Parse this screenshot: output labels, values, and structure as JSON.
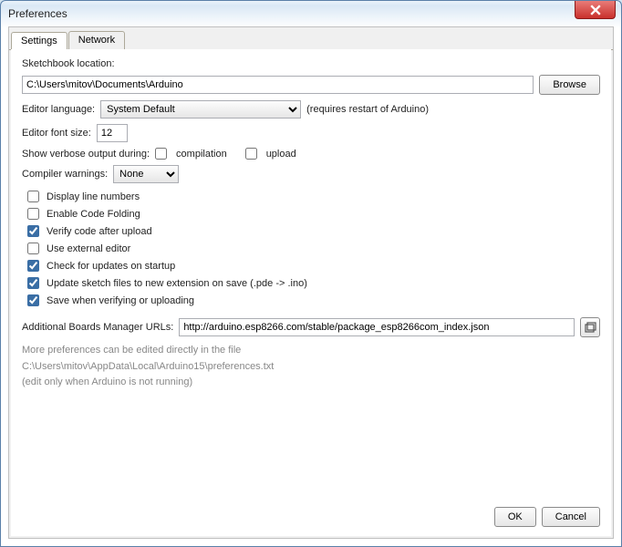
{
  "window": {
    "title": "Preferences"
  },
  "tabs": {
    "settings": "Settings",
    "network": "Network"
  },
  "sketchbook": {
    "label": "Sketchbook location:",
    "value": "C:\\Users\\mitov\\Documents\\Arduino",
    "browse": "Browse"
  },
  "language": {
    "label": "Editor language:",
    "value": "System Default",
    "note": "(requires restart of Arduino)"
  },
  "fontsize": {
    "label": "Editor font size:",
    "value": "12"
  },
  "verbose": {
    "label": "Show verbose output during:",
    "compilation": "compilation",
    "upload": "upload"
  },
  "warnings": {
    "label": "Compiler warnings:",
    "value": "None"
  },
  "checks": {
    "line_numbers": "Display line numbers",
    "code_folding": "Enable Code Folding",
    "verify_upload": "Verify code after upload",
    "external_editor": "Use external editor",
    "check_updates": "Check for updates on startup",
    "update_ext": "Update sketch files to new extension on save (.pde -> .ino)",
    "save_verify": "Save when verifying or uploading"
  },
  "boards": {
    "label": "Additional Boards Manager URLs:",
    "value": "http://arduino.esp8266.com/stable/package_esp8266com_index.json"
  },
  "notes": {
    "l1": "More preferences can be edited directly in the file",
    "l2": "C:\\Users\\mitov\\AppData\\Local\\Arduino15\\preferences.txt",
    "l3": "(edit only when Arduino is not running)"
  },
  "buttons": {
    "ok": "OK",
    "cancel": "Cancel"
  }
}
